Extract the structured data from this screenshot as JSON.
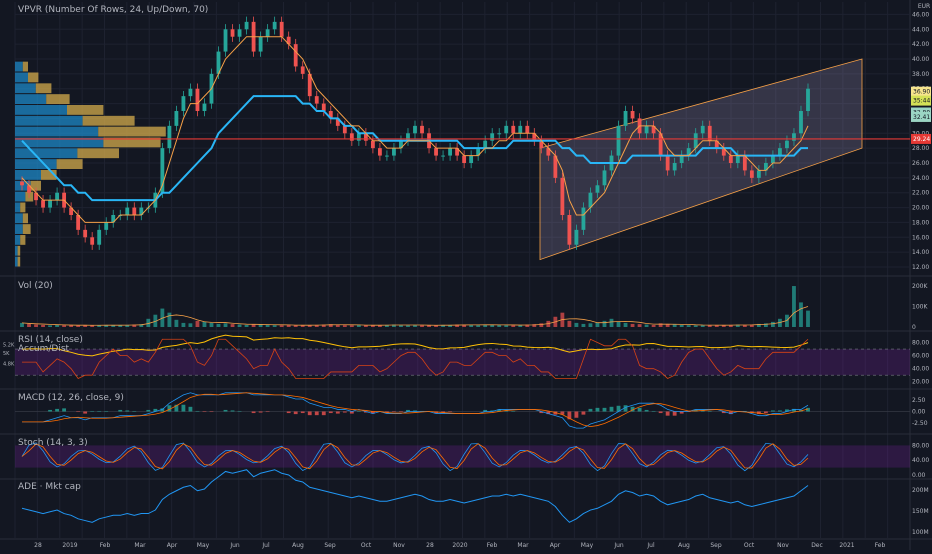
{
  "chart_data": {
    "type": "candlestick",
    "main": {
      "legend": "VPVR (Number Of Rows, 24, Up/Down, 70)",
      "currency": "EUR",
      "price_labels": {
        "a": "36.90",
        "b": "35:44:06",
        "c": "32.80",
        "d": "32.41",
        "e": "29.24"
      },
      "hline_price": 29.24,
      "y_ticks": [
        "46.00",
        "44.00",
        "42.00",
        "40.00",
        "38.00",
        "36.00",
        "34.00",
        "32.00",
        "30.00",
        "28.00",
        "26.00",
        "24.00",
        "22.00",
        "20.00",
        "18.00",
        "16.00",
        "14.00",
        "12.00"
      ],
      "ylim": [
        12,
        47
      ],
      "close_series": [
        23,
        22,
        21,
        20,
        21,
        22,
        20,
        19,
        17,
        16,
        15,
        17,
        18,
        19,
        19,
        20,
        19,
        20,
        20,
        22,
        28,
        31,
        33,
        35,
        36,
        33,
        34,
        38,
        41,
        44,
        43,
        44,
        45,
        41,
        43,
        44,
        45,
        43,
        42,
        39,
        38,
        35,
        34,
        33,
        32,
        31,
        30,
        29,
        30,
        29,
        28,
        27,
        27,
        28,
        29,
        30,
        31,
        30,
        28,
        27,
        27,
        28,
        27,
        26,
        27,
        28,
        29,
        30,
        30,
        31,
        30,
        31,
        30,
        29,
        28,
        27,
        24,
        19,
        15,
        17,
        20,
        22,
        23,
        25,
        27,
        31,
        33,
        32,
        30,
        31,
        30,
        27,
        25,
        26,
        27,
        28,
        30,
        31,
        29,
        28,
        27,
        26,
        27,
        25,
        24,
        25,
        26,
        27,
        28,
        29,
        30,
        33,
        36
      ],
      "ma_fast": [
        24,
        23,
        22,
        21,
        21,
        21,
        21,
        20,
        19,
        18,
        18,
        18,
        18,
        18,
        19,
        19,
        19,
        19,
        20,
        21,
        23,
        26,
        29,
        32,
        34,
        34,
        35,
        36,
        38,
        40,
        41,
        42,
        43,
        43,
        43,
        43,
        43,
        43,
        42,
        41,
        40,
        38,
        36,
        35,
        34,
        33,
        32,
        31,
        31,
        30,
        29,
        29,
        28,
        28,
        28,
        29,
        29,
        29,
        29,
        28,
        28,
        28,
        28,
        27,
        27,
        27,
        28,
        28,
        29,
        29,
        30,
        30,
        30,
        30,
        29,
        28,
        27,
        25,
        21,
        19,
        19,
        20,
        21,
        22,
        24,
        26,
        28,
        30,
        31,
        31,
        31,
        30,
        28,
        27,
        27,
        27,
        28,
        29,
        29,
        29,
        28,
        27,
        27,
        27,
        26,
        25,
        25,
        26,
        26,
        27,
        28,
        29,
        31
      ],
      "ma_slow": [
        29,
        28,
        27,
        26,
        25,
        24,
        23,
        23,
        22,
        22,
        21,
        21,
        21,
        21,
        21,
        21,
        21,
        21,
        21,
        21,
        22,
        22,
        23,
        24,
        25,
        26,
        27,
        28,
        30,
        31,
        32,
        33,
        34,
        35,
        35,
        35,
        35,
        35,
        35,
        35,
        34,
        34,
        33,
        33,
        32,
        32,
        31,
        31,
        30,
        30,
        30,
        29,
        29,
        29,
        29,
        29,
        29,
        29,
        29,
        29,
        29,
        29,
        29,
        28,
        28,
        28,
        28,
        28,
        28,
        28,
        29,
        29,
        29,
        29,
        29,
        29,
        29,
        28,
        28,
        27,
        27,
        26,
        26,
        26,
        26,
        26,
        26,
        27,
        27,
        27,
        27,
        27,
        27,
        27,
        27,
        27,
        27,
        28,
        28,
        28,
        28,
        28,
        27,
        27,
        27,
        27,
        27,
        27,
        27,
        27,
        27,
        28,
        28
      ],
      "channel": {
        "upper_start": 28,
        "upper_end": 40,
        "lower_start": 13,
        "lower_end": 28
      },
      "vpvr_up": [
        0,
        0,
        0,
        0,
        0,
        3,
        5,
        8,
        12,
        20,
        26,
        32,
        34,
        24,
        16,
        10,
        6,
        4,
        2,
        3,
        3,
        2,
        1,
        1
      ],
      "vpvr_down": [
        0,
        0,
        0,
        0,
        0,
        2,
        4,
        6,
        9,
        14,
        20,
        26,
        22,
        16,
        10,
        6,
        4,
        3,
        2,
        2,
        3,
        2,
        1,
        1
      ]
    },
    "volume": {
      "legend": "Vol (20)",
      "y_ticks": [
        "200K",
        "100K",
        "0"
      ],
      "values": [
        20,
        15,
        12,
        10,
        8,
        12,
        9,
        8,
        7,
        10,
        8,
        9,
        10,
        9,
        8,
        10,
        12,
        14,
        40,
        60,
        90,
        70,
        35,
        20,
        18,
        30,
        25,
        20,
        15,
        18,
        14,
        12,
        10,
        12,
        14,
        10,
        9,
        8,
        10,
        9,
        8,
        9,
        10,
        12,
        14,
        10,
        9,
        8,
        10,
        9,
        8,
        9,
        10,
        12,
        9,
        8,
        10,
        9,
        8,
        8,
        9,
        10,
        12,
        11,
        10,
        9,
        12,
        11,
        10,
        9,
        8,
        9,
        12,
        14,
        18,
        30,
        50,
        70,
        30,
        20,
        15,
        18,
        22,
        30,
        40,
        25,
        20,
        15,
        14,
        12,
        10,
        18,
        15,
        12,
        10,
        9,
        8,
        9,
        10,
        9,
        8,
        10,
        12,
        10,
        12,
        15,
        18,
        25,
        40,
        60,
        200,
        120,
        80
      ]
    },
    "rsi": {
      "legend": "RSI (14, close)",
      "legend2": "Accum/Dist",
      "y_ticks": [
        "80.00",
        "60.00",
        "40.00",
        "20.00"
      ],
      "left_ticks": [
        "5.2K",
        "5K",
        "4.8K"
      ]
    },
    "macd": {
      "legend": "MACD (12, 26, close, 9)",
      "y_ticks": [
        "2.50",
        "0.00",
        "-2.50"
      ]
    },
    "stoch": {
      "legend": "Stoch (14, 3, 3)",
      "y_ticks": [
        "80.00",
        "40.00",
        "0.00"
      ]
    },
    "ade": {
      "legend": "ADE · Mkt cap",
      "y_ticks": [
        "200M",
        "150M",
        "100M"
      ]
    },
    "x_labels": [
      "28",
      "2019",
      "Feb",
      "Mar",
      "Apr",
      "May",
      "Jun",
      "Jul",
      "Aug",
      "Sep",
      "Oct",
      "Nov",
      "28",
      "2020",
      "Feb",
      "Mar",
      "Apr",
      "May",
      "Jun",
      "Jul",
      "Aug",
      "Sep",
      "Oct",
      "Nov",
      "Dec",
      "2021",
      "Feb"
    ],
    "colors": {
      "up": "#26a69a",
      "down": "#ef5350",
      "ma_fast": "#f6a047",
      "ma_slow": "#29b6f6",
      "hline": "#e53935",
      "rsi": "#ffc107",
      "ad": "#d84315",
      "bg": "#131722"
    }
  }
}
